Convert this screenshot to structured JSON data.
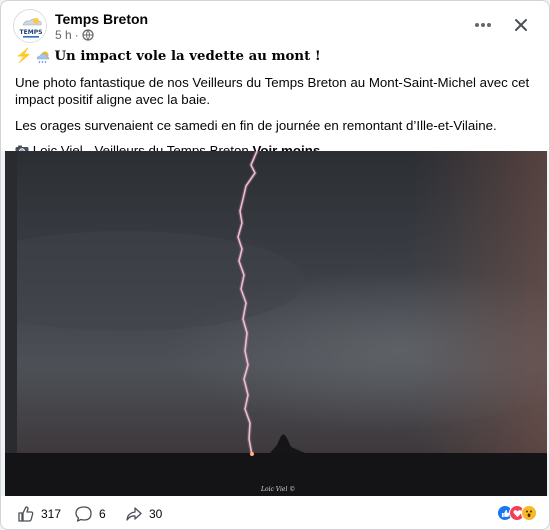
{
  "post": {
    "author": "Temps Breton",
    "avatar_text": "TEMPS",
    "time": "5 h",
    "separator": "·",
    "title": "Un impact vole la vedette au mont !",
    "paragraph1": "Une photo fantastique de nos Veilleurs du Temps Breton au Mont-Saint-Michel avec cet impact positif aligne avec la baie.",
    "paragraph2": "Les orages survenaient ce samedi en fin de journée en remontant d’Ille-et-Vilaine.",
    "credit": "Loic Viel - Veilleurs du Temps Breton",
    "see_less": "Voir moins",
    "watermark": "Loic Viel ©"
  },
  "footer": {
    "likes": "317",
    "comments": "6",
    "shares": "30"
  },
  "icons": {
    "title_icons": [
      "lightning-icon",
      "storm-cloud-icon"
    ],
    "credit_icon": "camera-icon",
    "reactions": [
      "like-reaction-icon",
      "love-reaction-icon",
      "wow-reaction-icon"
    ]
  },
  "colors": {
    "like_blue": "#1877f2",
    "love_red": "#f33e58",
    "wow_yellow": "#f7b928",
    "text_secondary": "#65676b"
  }
}
